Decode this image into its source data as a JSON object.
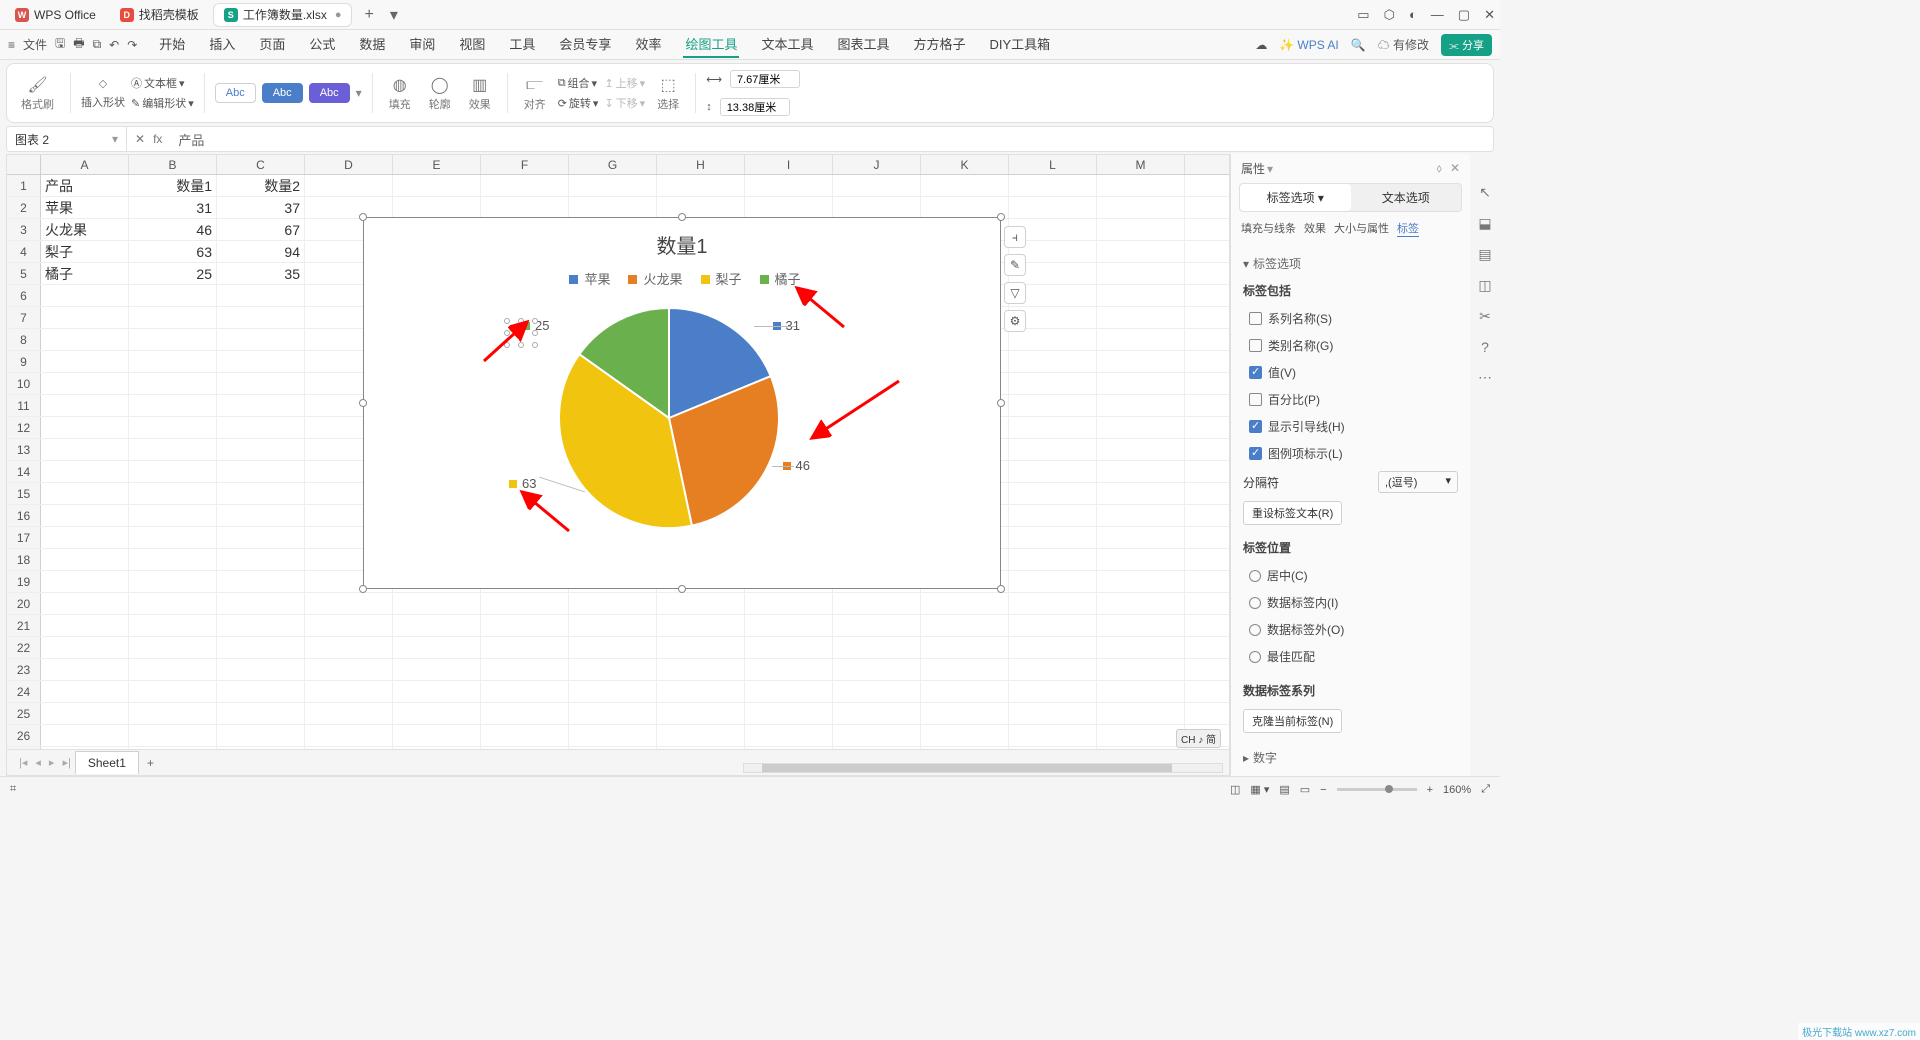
{
  "titlebar": {
    "tabs": [
      {
        "icon_bg": "#d9534f",
        "icon_txt": "W",
        "label": "WPS Office"
      },
      {
        "icon_bg": "#e74c3c",
        "icon_txt": "D",
        "label": "找稻壳模板"
      },
      {
        "icon_bg": "#16a085",
        "icon_txt": "S",
        "label": "工作簿数量.xlsx",
        "active": true
      }
    ],
    "add": "+"
  },
  "menubar": {
    "file": "文件",
    "items": [
      "开始",
      "插入",
      "页面",
      "公式",
      "数据",
      "审阅",
      "视图",
      "工具",
      "会员专享",
      "效率",
      "绘图工具",
      "文本工具",
      "图表工具",
      "方方格子",
      "DIY工具箱"
    ],
    "green_index": 10,
    "wpsai": "WPS AI",
    "modify": "有修改",
    "share": "分享"
  },
  "ribbon": {
    "format_painter": "格式刷",
    "insert_shape": "插入形状",
    "textbox": "文本框",
    "edit_shape": "编辑形状",
    "abc": "Abc",
    "fill": "填充",
    "outline": "轮廓",
    "effect": "效果",
    "align": "对齐",
    "group": "组合",
    "rotate": "旋转",
    "moveup": "上移",
    "movedown": "下移",
    "select": "选择",
    "width": "7.67厘米",
    "height": "13.38厘米"
  },
  "formula_bar": {
    "name": "图表 2",
    "fx": "fx",
    "content": "产品"
  },
  "sheet": {
    "cols": [
      "A",
      "B",
      "C",
      "D",
      "E",
      "F",
      "G",
      "H",
      "I",
      "J",
      "K",
      "L",
      "M"
    ],
    "rows": [
      [
        "产品",
        "数量1",
        "数量2"
      ],
      [
        "苹果",
        "31",
        "37"
      ],
      [
        "火龙果",
        "46",
        "67"
      ],
      [
        "梨子",
        "63",
        "94"
      ],
      [
        "橘子",
        "25",
        "35"
      ]
    ],
    "total_rows": 27
  },
  "chart_data": {
    "type": "pie",
    "title": "数量1",
    "categories": [
      "苹果",
      "火龙果",
      "梨子",
      "橘子"
    ],
    "values": [
      31,
      46,
      63,
      25
    ],
    "colors": [
      "#4a7ec8",
      "#e67e22",
      "#f1c40f",
      "#6ab04c"
    ],
    "labels": {
      "苹果": "31",
      "火龙果": "46",
      "梨子": "63",
      "橘子": "25"
    }
  },
  "chart_side_buttons": [
    "chart-elements",
    "brush",
    "filter",
    "settings"
  ],
  "panel": {
    "title": "属性",
    "tabs": [
      "标签选项",
      "文本选项"
    ],
    "subtabs": [
      "填充与线条",
      "效果",
      "大小与属性",
      "标签"
    ],
    "sec_options": "标签选项",
    "label_includes": "标签包括",
    "chk_series": "系列名称(S)",
    "chk_category": "类别名称(G)",
    "chk_value": "值(V)",
    "chk_percent": "百分比(P)",
    "chk_leader": "显示引导线(H)",
    "chk_legendkey": "图例项标示(L)",
    "separator_label": "分隔符",
    "separator_value": ",(逗号)",
    "reset_btn": "重设标签文本(R)",
    "position_label": "标签位置",
    "pos_center": "居中(C)",
    "pos_inside": "数据标签内(I)",
    "pos_outside": "数据标签外(O)",
    "pos_bestfit": "最佳匹配",
    "data_series": "数据标签系列",
    "clone_btn": "克隆当前标签(N)",
    "numbers": "数字"
  },
  "sheet_tab": {
    "name": "Sheet1"
  },
  "statusbar": {
    "zoom": "160%"
  },
  "ime": "CH ♪ 简",
  "watermark": "极光下载站 www.xz7.com"
}
